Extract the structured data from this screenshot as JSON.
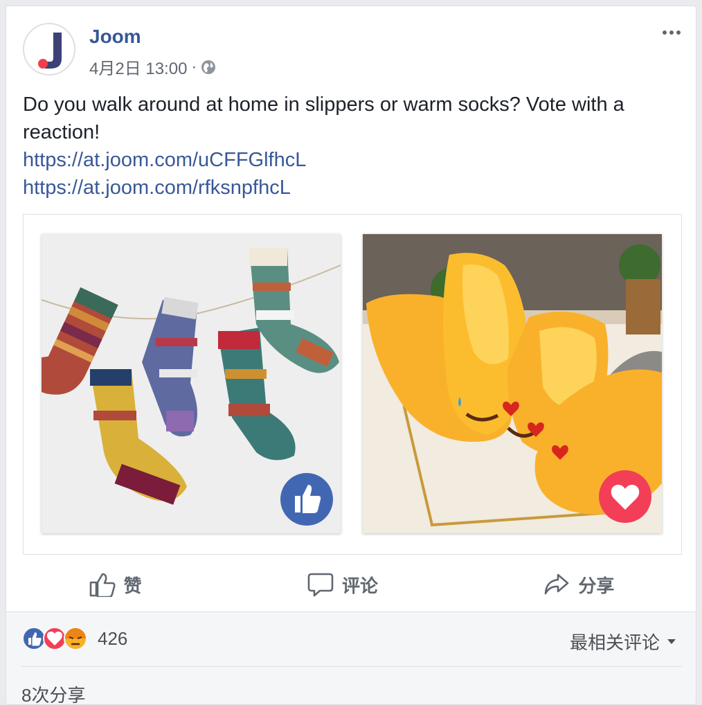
{
  "post": {
    "page_name": "Joom",
    "date": "4月2日 13:00",
    "separator": "·",
    "privacy_icon": "globe-icon",
    "text": "Do you walk around at home in slippers or warm socks? Vote with a reaction!",
    "links": [
      "https://at.joom.com/uCFFGlfhcL",
      "https://at.joom.com/rfksnpfhcL"
    ],
    "images": [
      {
        "subject": "socks",
        "badge": "like-icon",
        "badge_color": "#4267b2"
      },
      {
        "subject": "slippers",
        "badge": "heart-icon",
        "badge_color": "#f33e58"
      }
    ]
  },
  "actions": {
    "like": "赞",
    "comment": "评论",
    "share": "分享"
  },
  "footer": {
    "reaction_icons": [
      "like-icon",
      "love-icon",
      "angry-icon"
    ],
    "reaction_count": "426",
    "sort_label": "最相关评论",
    "shares": "8次分享"
  },
  "colors": {
    "link": "#385898",
    "brand_blue": "#365899",
    "like_blue": "#4267b2",
    "love_red": "#f33e58"
  }
}
